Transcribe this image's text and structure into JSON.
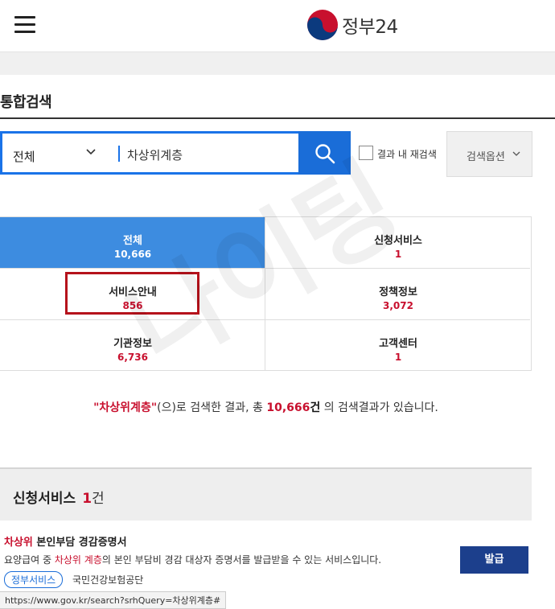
{
  "header": {
    "logo_text": "정부24"
  },
  "page": {
    "title": "통합검색"
  },
  "search": {
    "scope": "전체",
    "query": "차상위계층",
    "in_result_label": "결과 내 재검색",
    "options_label": "검색옵션"
  },
  "categories": [
    {
      "name": "전체",
      "count": "10,666",
      "active": true
    },
    {
      "name": "신청서비스",
      "count": "1"
    },
    {
      "name": "서비스안내",
      "count": "856"
    },
    {
      "name": "정책정보",
      "count": "3,072"
    },
    {
      "name": "기관정보",
      "count": "6,736"
    },
    {
      "name": "고객센터",
      "count": "1"
    }
  ],
  "summary": {
    "query_quoted": "\"차상위계층\"",
    "text1": "(으)로 검색한 결과, 총 ",
    "total": "10,666",
    "unit": "건",
    "text2": " 의 검색결과가 있습니다."
  },
  "section": {
    "title": "신청서비스",
    "count": "1",
    "unit": "건"
  },
  "result": {
    "title_hl": "차상위",
    "title_rest": " 본인부담 경감증명서",
    "desc_prefix": "요양급여 중 ",
    "desc_hl": "차상위 계층",
    "desc_rest": "의 본인 부담비 경감 대상자 증명서를 발급받을 수 있는 서비스입니다.",
    "tag": "정부서비스",
    "org": "국민건강보험공단",
    "button": "발급"
  },
  "statusbar": {
    "url": "https://www.gov.kr/search?srhQuery=차상위계층#"
  },
  "watermark": "나이팅",
  "colors": {
    "accent": "#1a6dd8",
    "active_cell": "#3d8ce0",
    "highlight": "#c8102e",
    "issue_button": "#1c3f8c",
    "annotation_box": "#b5121b"
  },
  "icons": [
    "menu-icon",
    "government-logo-icon",
    "chevron-down-icon",
    "search-icon",
    "checkbox-icon"
  ]
}
